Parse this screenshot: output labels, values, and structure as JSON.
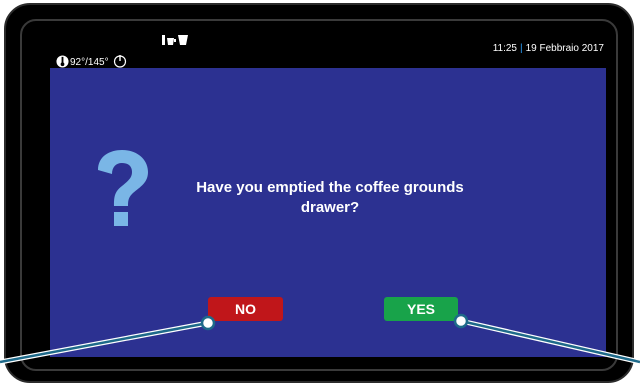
{
  "status": {
    "temperature": "92°/145°",
    "time": "11:25",
    "date": "19 Febbraio 2017",
    "separator": "|"
  },
  "dialog": {
    "prompt": "Have you emptied the coffee grounds drawer?",
    "no_label": "NO",
    "yes_label": "YES"
  },
  "colors": {
    "screen_bg": "#2c3191",
    "no_button": "#c0161a",
    "yes_button": "#18a34a",
    "question_icon": "#7ab6e6",
    "date_separator": "#2ea3ff"
  },
  "icons": [
    "thermometer-icon",
    "power-icon",
    "cups-icon",
    "question-mark-icon"
  ]
}
